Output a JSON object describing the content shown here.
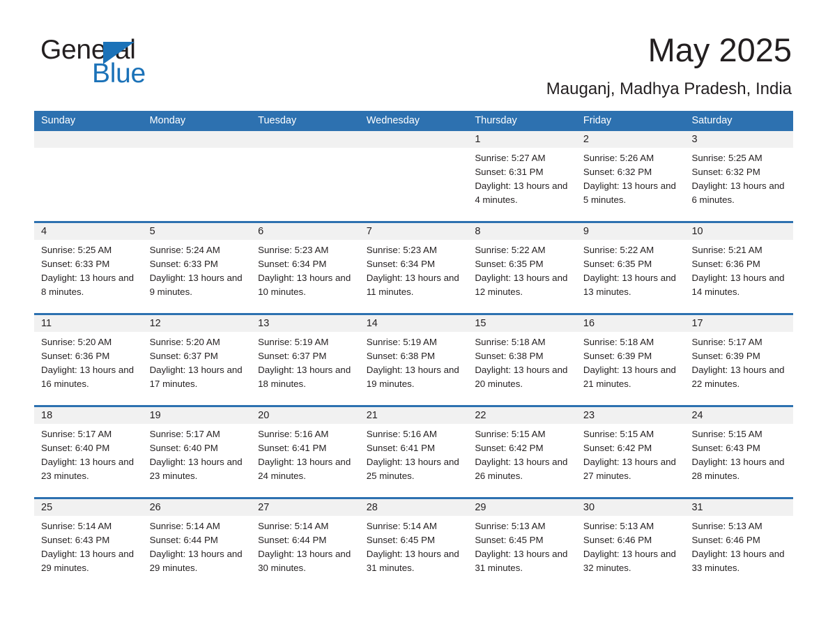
{
  "brand": {
    "name_part1": "General",
    "name_part2": "Blue",
    "accent_color": "#1b72b8"
  },
  "header": {
    "title": "May 2025",
    "subtitle": "Mauganj, Madhya Pradesh, India"
  },
  "calendar": {
    "header_bg": "#2d71b0",
    "day_band_bg": "#f1f1f1",
    "weekdays": [
      "Sunday",
      "Monday",
      "Tuesday",
      "Wednesday",
      "Thursday",
      "Friday",
      "Saturday"
    ],
    "weeks": [
      [
        {
          "day": "",
          "empty": true
        },
        {
          "day": "",
          "empty": true
        },
        {
          "day": "",
          "empty": true
        },
        {
          "day": "",
          "empty": true
        },
        {
          "day": "1",
          "sunrise": "Sunrise: 5:27 AM",
          "sunset": "Sunset: 6:31 PM",
          "daylight": "Daylight: 13 hours and 4 minutes."
        },
        {
          "day": "2",
          "sunrise": "Sunrise: 5:26 AM",
          "sunset": "Sunset: 6:32 PM",
          "daylight": "Daylight: 13 hours and 5 minutes."
        },
        {
          "day": "3",
          "sunrise": "Sunrise: 5:25 AM",
          "sunset": "Sunset: 6:32 PM",
          "daylight": "Daylight: 13 hours and 6 minutes."
        }
      ],
      [
        {
          "day": "4",
          "sunrise": "Sunrise: 5:25 AM",
          "sunset": "Sunset: 6:33 PM",
          "daylight": "Daylight: 13 hours and 8 minutes."
        },
        {
          "day": "5",
          "sunrise": "Sunrise: 5:24 AM",
          "sunset": "Sunset: 6:33 PM",
          "daylight": "Daylight: 13 hours and 9 minutes."
        },
        {
          "day": "6",
          "sunrise": "Sunrise: 5:23 AM",
          "sunset": "Sunset: 6:34 PM",
          "daylight": "Daylight: 13 hours and 10 minutes."
        },
        {
          "day": "7",
          "sunrise": "Sunrise: 5:23 AM",
          "sunset": "Sunset: 6:34 PM",
          "daylight": "Daylight: 13 hours and 11 minutes."
        },
        {
          "day": "8",
          "sunrise": "Sunrise: 5:22 AM",
          "sunset": "Sunset: 6:35 PM",
          "daylight": "Daylight: 13 hours and 12 minutes."
        },
        {
          "day": "9",
          "sunrise": "Sunrise: 5:22 AM",
          "sunset": "Sunset: 6:35 PM",
          "daylight": "Daylight: 13 hours and 13 minutes."
        },
        {
          "day": "10",
          "sunrise": "Sunrise: 5:21 AM",
          "sunset": "Sunset: 6:36 PM",
          "daylight": "Daylight: 13 hours and 14 minutes."
        }
      ],
      [
        {
          "day": "11",
          "sunrise": "Sunrise: 5:20 AM",
          "sunset": "Sunset: 6:36 PM",
          "daylight": "Daylight: 13 hours and 16 minutes."
        },
        {
          "day": "12",
          "sunrise": "Sunrise: 5:20 AM",
          "sunset": "Sunset: 6:37 PM",
          "daylight": "Daylight: 13 hours and 17 minutes."
        },
        {
          "day": "13",
          "sunrise": "Sunrise: 5:19 AM",
          "sunset": "Sunset: 6:37 PM",
          "daylight": "Daylight: 13 hours and 18 minutes."
        },
        {
          "day": "14",
          "sunrise": "Sunrise: 5:19 AM",
          "sunset": "Sunset: 6:38 PM",
          "daylight": "Daylight: 13 hours and 19 minutes."
        },
        {
          "day": "15",
          "sunrise": "Sunrise: 5:18 AM",
          "sunset": "Sunset: 6:38 PM",
          "daylight": "Daylight: 13 hours and 20 minutes."
        },
        {
          "day": "16",
          "sunrise": "Sunrise: 5:18 AM",
          "sunset": "Sunset: 6:39 PM",
          "daylight": "Daylight: 13 hours and 21 minutes."
        },
        {
          "day": "17",
          "sunrise": "Sunrise: 5:17 AM",
          "sunset": "Sunset: 6:39 PM",
          "daylight": "Daylight: 13 hours and 22 minutes."
        }
      ],
      [
        {
          "day": "18",
          "sunrise": "Sunrise: 5:17 AM",
          "sunset": "Sunset: 6:40 PM",
          "daylight": "Daylight: 13 hours and 23 minutes."
        },
        {
          "day": "19",
          "sunrise": "Sunrise: 5:17 AM",
          "sunset": "Sunset: 6:40 PM",
          "daylight": "Daylight: 13 hours and 23 minutes."
        },
        {
          "day": "20",
          "sunrise": "Sunrise: 5:16 AM",
          "sunset": "Sunset: 6:41 PM",
          "daylight": "Daylight: 13 hours and 24 minutes."
        },
        {
          "day": "21",
          "sunrise": "Sunrise: 5:16 AM",
          "sunset": "Sunset: 6:41 PM",
          "daylight": "Daylight: 13 hours and 25 minutes."
        },
        {
          "day": "22",
          "sunrise": "Sunrise: 5:15 AM",
          "sunset": "Sunset: 6:42 PM",
          "daylight": "Daylight: 13 hours and 26 minutes."
        },
        {
          "day": "23",
          "sunrise": "Sunrise: 5:15 AM",
          "sunset": "Sunset: 6:42 PM",
          "daylight": "Daylight: 13 hours and 27 minutes."
        },
        {
          "day": "24",
          "sunrise": "Sunrise: 5:15 AM",
          "sunset": "Sunset: 6:43 PM",
          "daylight": "Daylight: 13 hours and 28 minutes."
        }
      ],
      [
        {
          "day": "25",
          "sunrise": "Sunrise: 5:14 AM",
          "sunset": "Sunset: 6:43 PM",
          "daylight": "Daylight: 13 hours and 29 minutes."
        },
        {
          "day": "26",
          "sunrise": "Sunrise: 5:14 AM",
          "sunset": "Sunset: 6:44 PM",
          "daylight": "Daylight: 13 hours and 29 minutes."
        },
        {
          "day": "27",
          "sunrise": "Sunrise: 5:14 AM",
          "sunset": "Sunset: 6:44 PM",
          "daylight": "Daylight: 13 hours and 30 minutes."
        },
        {
          "day": "28",
          "sunrise": "Sunrise: 5:14 AM",
          "sunset": "Sunset: 6:45 PM",
          "daylight": "Daylight: 13 hours and 31 minutes."
        },
        {
          "day": "29",
          "sunrise": "Sunrise: 5:13 AM",
          "sunset": "Sunset: 6:45 PM",
          "daylight": "Daylight: 13 hours and 31 minutes."
        },
        {
          "day": "30",
          "sunrise": "Sunrise: 5:13 AM",
          "sunset": "Sunset: 6:46 PM",
          "daylight": "Daylight: 13 hours and 32 minutes."
        },
        {
          "day": "31",
          "sunrise": "Sunrise: 5:13 AM",
          "sunset": "Sunset: 6:46 PM",
          "daylight": "Daylight: 13 hours and 33 minutes."
        }
      ]
    ]
  }
}
